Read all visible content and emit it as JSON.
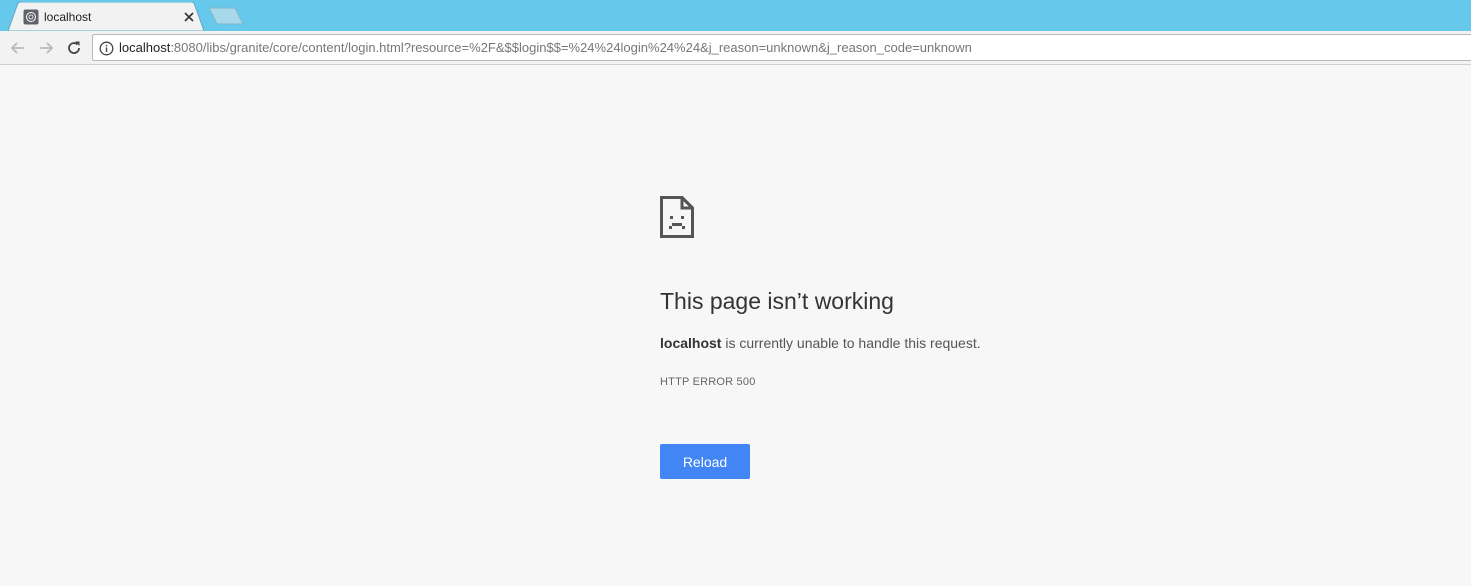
{
  "tab": {
    "title": "localhost"
  },
  "omnibox": {
    "url_host": "localhost",
    "url_rest": ":8080/libs/granite/core/content/login.html?resource=%2F&$$login$$=%24%24login%24%24&j_reason=unknown&j_reason_code=unknown"
  },
  "error": {
    "title": "This page isn’t working",
    "host": "localhost",
    "message": " is currently unable to handle this request.",
    "code": "HTTP ERROR 500",
    "reload_label": "Reload"
  },
  "colors": {
    "tabstrip": "#66c8ea",
    "button": "#4285f4",
    "background": "#f7f7f7"
  }
}
